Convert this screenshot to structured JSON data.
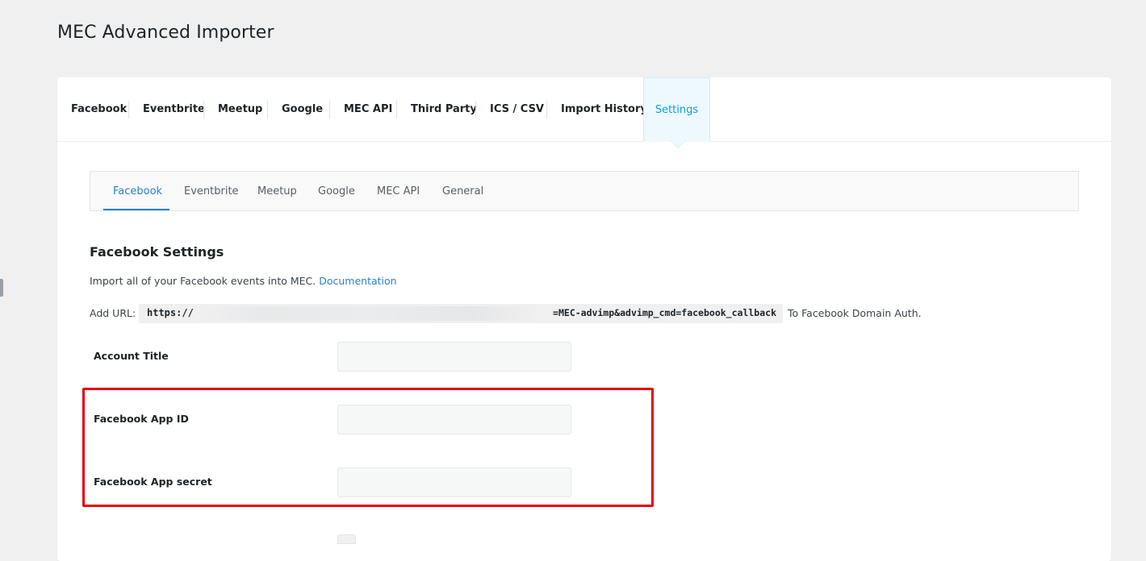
{
  "page": {
    "title": "MEC Advanced Importer"
  },
  "main_tabs": [
    {
      "label": "Facebook"
    },
    {
      "label": "Eventbrite"
    },
    {
      "label": "Meetup"
    },
    {
      "label": "Google"
    },
    {
      "label": "MEC API"
    },
    {
      "label": "Third Party"
    },
    {
      "label": "ICS / CSV"
    },
    {
      "label": "Import History"
    },
    {
      "label": "Settings",
      "active": true
    }
  ],
  "sub_tabs": [
    {
      "label": "Facebook",
      "active": true
    },
    {
      "label": "Eventbrite"
    },
    {
      "label": "Meetup"
    },
    {
      "label": "Google"
    },
    {
      "label": "MEC API"
    },
    {
      "label": "General"
    }
  ],
  "section": {
    "title": "Facebook Settings",
    "description": "Import all of your Facebook events into MEC.",
    "doc_link": "Documentation",
    "url_label": "Add URL:",
    "url_prefix": "https://",
    "url_suffix": "=MEC-advimp&advimp_cmd=facebook_callback",
    "url_after": "To Facebook Domain Auth."
  },
  "fields": {
    "account_title": {
      "label": "Account Title",
      "value": "",
      "placeholder": ""
    },
    "app_id": {
      "label": "Facebook App ID",
      "value": "",
      "placeholder": ""
    },
    "app_secret": {
      "label": "Facebook App secret",
      "value": "",
      "placeholder": ""
    }
  },
  "colors": {
    "accent": "#2a7fd4",
    "active_main_tab": "#0aa0d6",
    "highlight": "#e4000f"
  }
}
